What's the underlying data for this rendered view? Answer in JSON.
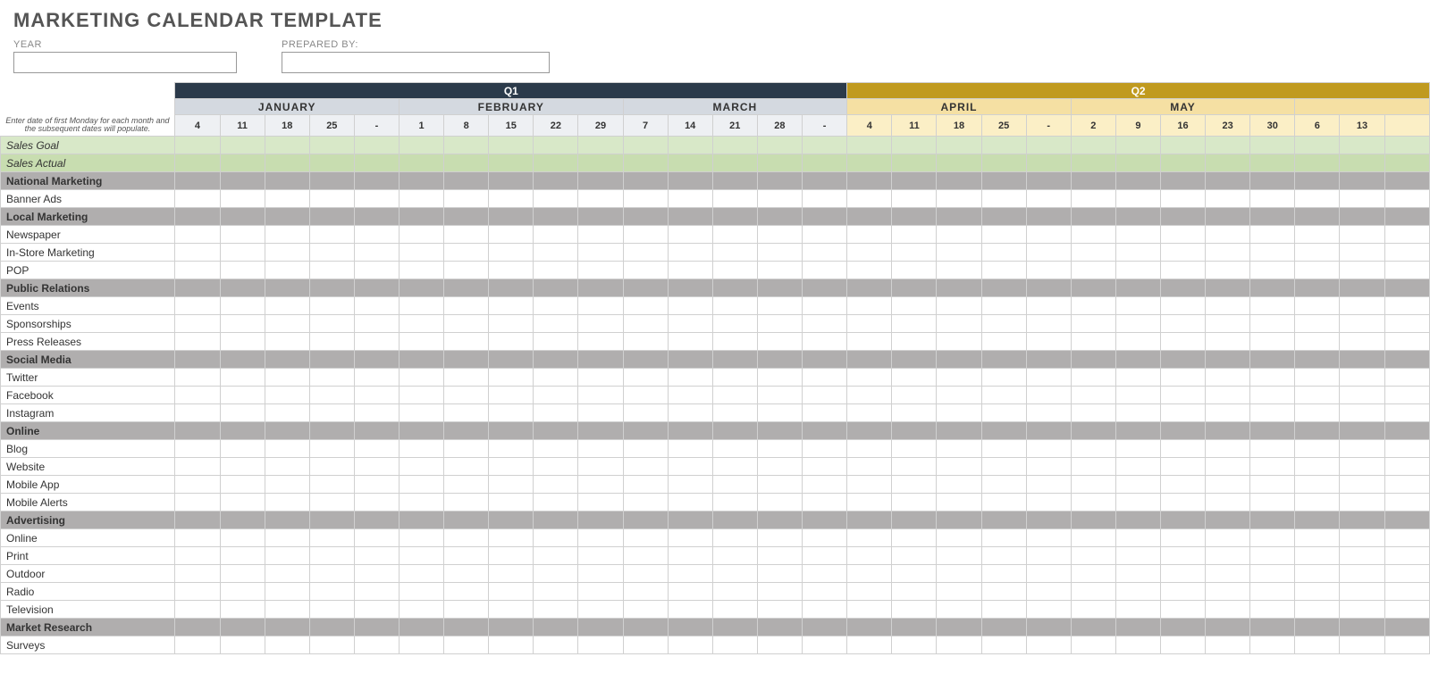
{
  "title": "MARKETING CALENDAR TEMPLATE",
  "meta": {
    "year_label": "YEAR",
    "year_value": "",
    "prepared_label": "PREPARED BY:",
    "prepared_value": ""
  },
  "note": "Enter date of first Monday for each month and the subsequent dates will populate.",
  "quarters": [
    {
      "label": "Q1",
      "span": 15,
      "cls": "quarter-q1"
    },
    {
      "label": "Q2",
      "span": 13,
      "cls": "quarter-q2"
    }
  ],
  "months": [
    {
      "label": "JANUARY",
      "span": 5,
      "cls": "month-q1"
    },
    {
      "label": "FEBRUARY",
      "span": 5,
      "cls": "month-q1"
    },
    {
      "label": "MARCH",
      "span": 5,
      "cls": "month-q1"
    },
    {
      "label": "APRIL",
      "span": 5,
      "cls": "month-q2"
    },
    {
      "label": "MAY",
      "span": 5,
      "cls": "month-q2"
    },
    {
      "label": "",
      "span": 3,
      "cls": "month-q2"
    }
  ],
  "dates": [
    {
      "v": "4",
      "cls": "date-q1"
    },
    {
      "v": "11",
      "cls": "date-q1"
    },
    {
      "v": "18",
      "cls": "date-q1"
    },
    {
      "v": "25",
      "cls": "date-q1"
    },
    {
      "v": "-",
      "cls": "date-q1"
    },
    {
      "v": "1",
      "cls": "date-q1"
    },
    {
      "v": "8",
      "cls": "date-q1"
    },
    {
      "v": "15",
      "cls": "date-q1"
    },
    {
      "v": "22",
      "cls": "date-q1"
    },
    {
      "v": "29",
      "cls": "date-q1"
    },
    {
      "v": "7",
      "cls": "date-q1"
    },
    {
      "v": "14",
      "cls": "date-q1"
    },
    {
      "v": "21",
      "cls": "date-q1"
    },
    {
      "v": "28",
      "cls": "date-q1"
    },
    {
      "v": "-",
      "cls": "date-q1"
    },
    {
      "v": "4",
      "cls": "date-q2"
    },
    {
      "v": "11",
      "cls": "date-q2"
    },
    {
      "v": "18",
      "cls": "date-q2"
    },
    {
      "v": "25",
      "cls": "date-q2"
    },
    {
      "v": "-",
      "cls": "date-q2"
    },
    {
      "v": "2",
      "cls": "date-q2"
    },
    {
      "v": "9",
      "cls": "date-q2"
    },
    {
      "v": "16",
      "cls": "date-q2"
    },
    {
      "v": "23",
      "cls": "date-q2"
    },
    {
      "v": "30",
      "cls": "date-q2"
    },
    {
      "v": "6",
      "cls": "date-q2"
    },
    {
      "v": "13",
      "cls": "date-q2"
    },
    {
      "v": "",
      "cls": "date-q2"
    }
  ],
  "rows": [
    {
      "label": "Sales Goal",
      "type": "sales-goal"
    },
    {
      "label": "Sales Actual",
      "type": "sales-actual"
    },
    {
      "label": "National Marketing",
      "type": "section-hdr"
    },
    {
      "label": "Banner Ads",
      "type": "data-row"
    },
    {
      "label": "Local Marketing",
      "type": "section-hdr"
    },
    {
      "label": "Newspaper",
      "type": "data-row"
    },
    {
      "label": "In-Store Marketing",
      "type": "data-row"
    },
    {
      "label": "POP",
      "type": "data-row"
    },
    {
      "label": "Public Relations",
      "type": "section-hdr"
    },
    {
      "label": "Events",
      "type": "data-row"
    },
    {
      "label": "Sponsorships",
      "type": "data-row"
    },
    {
      "label": "Press Releases",
      "type": "data-row"
    },
    {
      "label": "Social Media",
      "type": "section-hdr"
    },
    {
      "label": "Twitter",
      "type": "data-row"
    },
    {
      "label": "Facebook",
      "type": "data-row"
    },
    {
      "label": "Instagram",
      "type": "data-row"
    },
    {
      "label": "Online",
      "type": "section-hdr"
    },
    {
      "label": "Blog",
      "type": "data-row"
    },
    {
      "label": "Website",
      "type": "data-row"
    },
    {
      "label": "Mobile App",
      "type": "data-row"
    },
    {
      "label": "Mobile Alerts",
      "type": "data-row"
    },
    {
      "label": "Advertising",
      "type": "section-hdr"
    },
    {
      "label": "Online",
      "type": "data-row"
    },
    {
      "label": "Print",
      "type": "data-row"
    },
    {
      "label": "Outdoor",
      "type": "data-row"
    },
    {
      "label": "Radio",
      "type": "data-row"
    },
    {
      "label": "Television",
      "type": "data-row"
    },
    {
      "label": "Market Research",
      "type": "section-hdr"
    },
    {
      "label": "Surveys",
      "type": "data-row"
    }
  ]
}
